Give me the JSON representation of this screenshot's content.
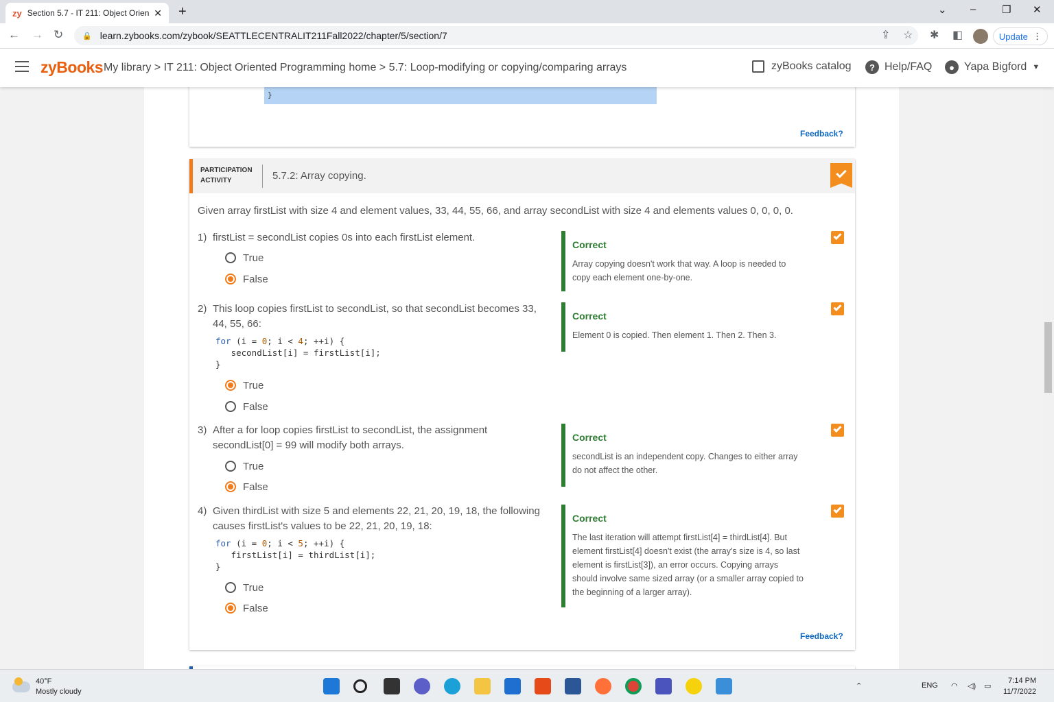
{
  "browser": {
    "tab_title": "Section 5.7 - IT 211: Object Orien",
    "tab_favicon": "zy",
    "url": "learn.zybooks.com/zybook/SEATTLECENTRALIT211Fall2022/chapter/5/section/7",
    "update_label": "Update"
  },
  "header": {
    "logo": "zyBooks",
    "breadcrumb": "My library > IT 211: Object Oriented Programming home > 5.7: Loop-modifying or copying/comparing arrays",
    "catalog": "zyBooks catalog",
    "help": "Help/FAQ",
    "user": "Yapa Bigford"
  },
  "prev_activity": {
    "code_tail": "}",
    "feedback": "Feedback?"
  },
  "activity": {
    "label": "PARTICIPATION ACTIVITY",
    "title": "5.7.2: Array copying.",
    "intro": "Given array firstList with size 4 and element values, 33, 44, 55, 66, and array secondList with size 4 and elements values 0, 0, 0, 0.",
    "feedback": "Feedback?",
    "questions": [
      {
        "num": "1)",
        "text": "firstList = secondList copies 0s into each firstList element.",
        "options": [
          "True",
          "False"
        ],
        "selected": "False",
        "result": "Correct",
        "explanation": "Array copying doesn't work that way. A loop is needed to copy each element one-by-one."
      },
      {
        "num": "2)",
        "text": "This loop copies firstList to secondList, so that secondList becomes 33, 44, 55, 66:",
        "code": [
          "for (i = 0; i < 4; ++i) {",
          "   secondList[i] = firstList[i];",
          "}"
        ],
        "options": [
          "True",
          "False"
        ],
        "selected": "True",
        "result": "Correct",
        "explanation": "Element 0 is copied. Then element 1. Then 2. Then 3."
      },
      {
        "num": "3)",
        "text": "After a for loop copies firstList to secondList, the assignment secondList[0] = 99 will modify both arrays.",
        "options": [
          "True",
          "False"
        ],
        "selected": "False",
        "result": "Correct",
        "explanation": "secondList is an independent copy. Changes to either array do not affect the other."
      },
      {
        "num": "4)",
        "text": "Given thirdList with size 5 and elements 22, 21, 20, 19, 18, the following causes firstList's values to be 22, 21, 20, 19, 18:",
        "code": [
          "for (i = 0; i < 5; ++i) {",
          "   firstList[i] = thirdList[i];",
          "}"
        ],
        "options": [
          "True",
          "False"
        ],
        "selected": "False",
        "result": "Correct",
        "explanation": "The last iteration will attempt firstList[4] = thirdList[4]. But element firstList[4] doesn't exist (the array's size is 4, so last element is firstList[3]), an error occurs. Copying arrays should involve same sized array (or a smaller array copied to the beginning of a larger array)."
      }
    ]
  },
  "taskbar": {
    "temp": "40°F",
    "weather": "Mostly cloudy",
    "lang": "ENG",
    "time": "7:14 PM",
    "date": "11/7/2022"
  },
  "colors": {
    "accent": "#f07c1b",
    "correct": "#2e7d32",
    "link": "#0a66c2"
  }
}
